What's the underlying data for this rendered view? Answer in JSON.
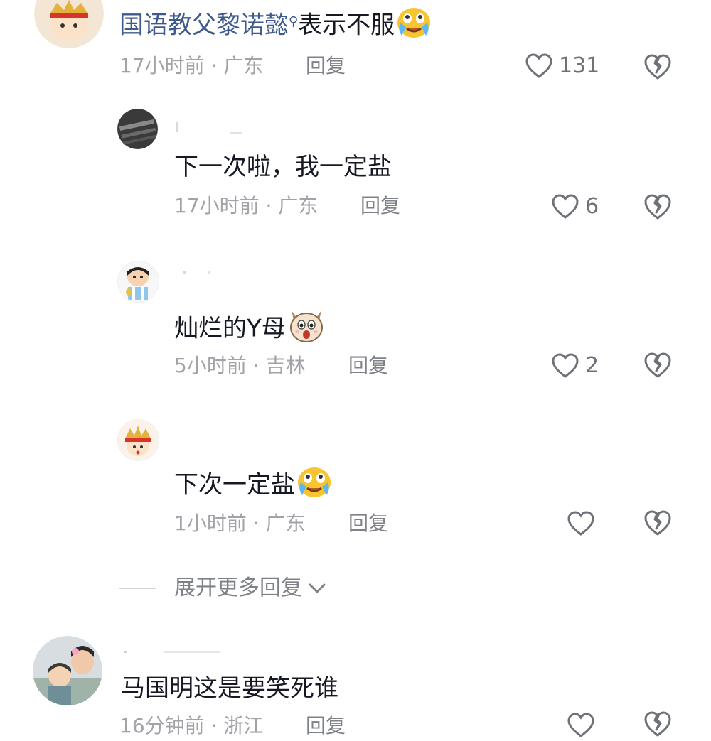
{
  "colors": {
    "text": "#161823",
    "meta": "#a1a3a8",
    "link": "#3e5a8c",
    "icon": "#6f7178"
  },
  "comments": [
    {
      "level": "top",
      "mention": "国语教父黎诺懿",
      "mention_icon": "search-icon",
      "text": "表示不服",
      "emoji": "crying-face-emoji",
      "meta": "17小时前 · 广东",
      "reply": "回复",
      "likes": "131"
    },
    {
      "level": "reply",
      "text": "下一次啦，我一定盐",
      "meta": "17小时前 · 广东",
      "reply": "回复",
      "likes": "6"
    },
    {
      "level": "reply",
      "text": "灿烂的Y母",
      "emoji": "surprised-dog-emoji",
      "meta": "5小时前 · 吉林",
      "reply": "回复",
      "likes": "2"
    },
    {
      "level": "reply",
      "text": "下次一定盐",
      "emoji": "crying-face-emoji",
      "meta": "1小时前 · 广东",
      "reply": "回复",
      "likes": ""
    },
    {
      "level": "top",
      "text": "马国明这是要笑死谁",
      "meta": "16分钟前 · 浙江",
      "reply": "回复",
      "likes": ""
    }
  ],
  "expand_replies": {
    "label": "展开更多回复",
    "icon": "chevron-down-icon"
  }
}
